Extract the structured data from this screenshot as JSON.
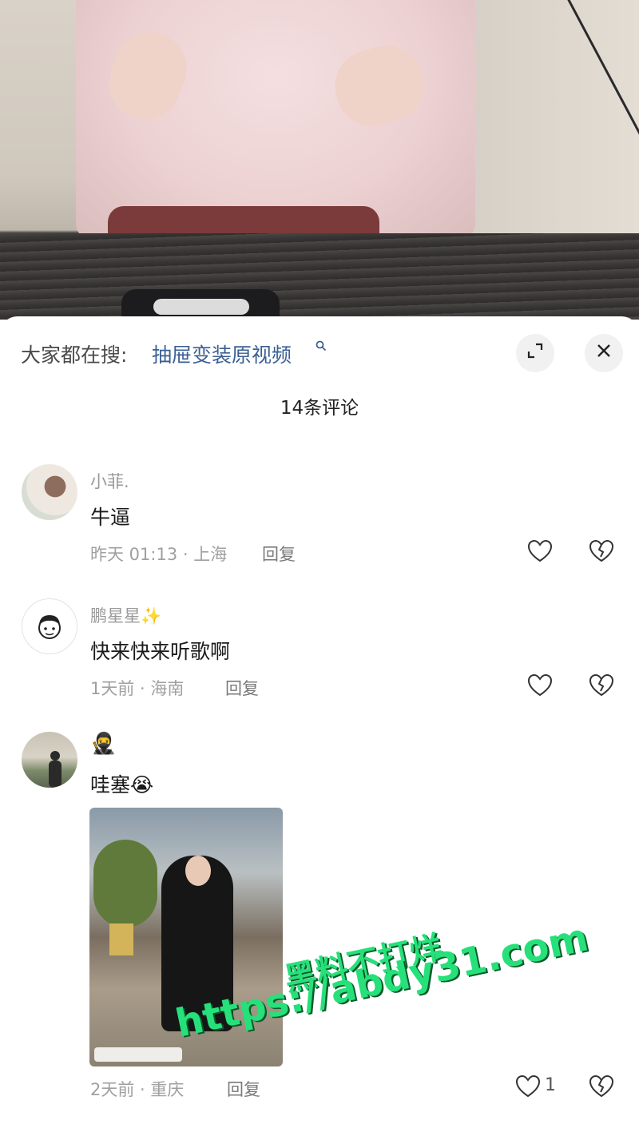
{
  "search": {
    "prefix": "大家都在搜:",
    "term": "抽屉变装原视频"
  },
  "comment_count": "14条评论",
  "comments": [
    {
      "name": "小菲.",
      "text": "牛逼",
      "meta": "昨天 01:13 · 上海",
      "reply": "回复",
      "likes": ""
    },
    {
      "name": "鹏星星",
      "name_emoji": "✨",
      "text": "快来快来听歌啊",
      "meta": "1天前 · 海南",
      "reply": "回复",
      "likes": ""
    },
    {
      "name": "",
      "name_emoji": "🥷",
      "text": "哇塞",
      "text_emoji": "😭",
      "meta": "2天前 · 重庆",
      "reply": "回复",
      "likes": "1"
    }
  ],
  "watermark": {
    "line1": "黑料不打烊",
    "line2": "https://abdy31.com"
  },
  "icons": {
    "search": "search-icon",
    "expand": "expand-icon",
    "close": "close-icon",
    "like": "heart-icon",
    "dislike": "broken-heart-icon"
  },
  "colors": {
    "search_term": "#3a5f94",
    "watermark": "#26e07a"
  }
}
